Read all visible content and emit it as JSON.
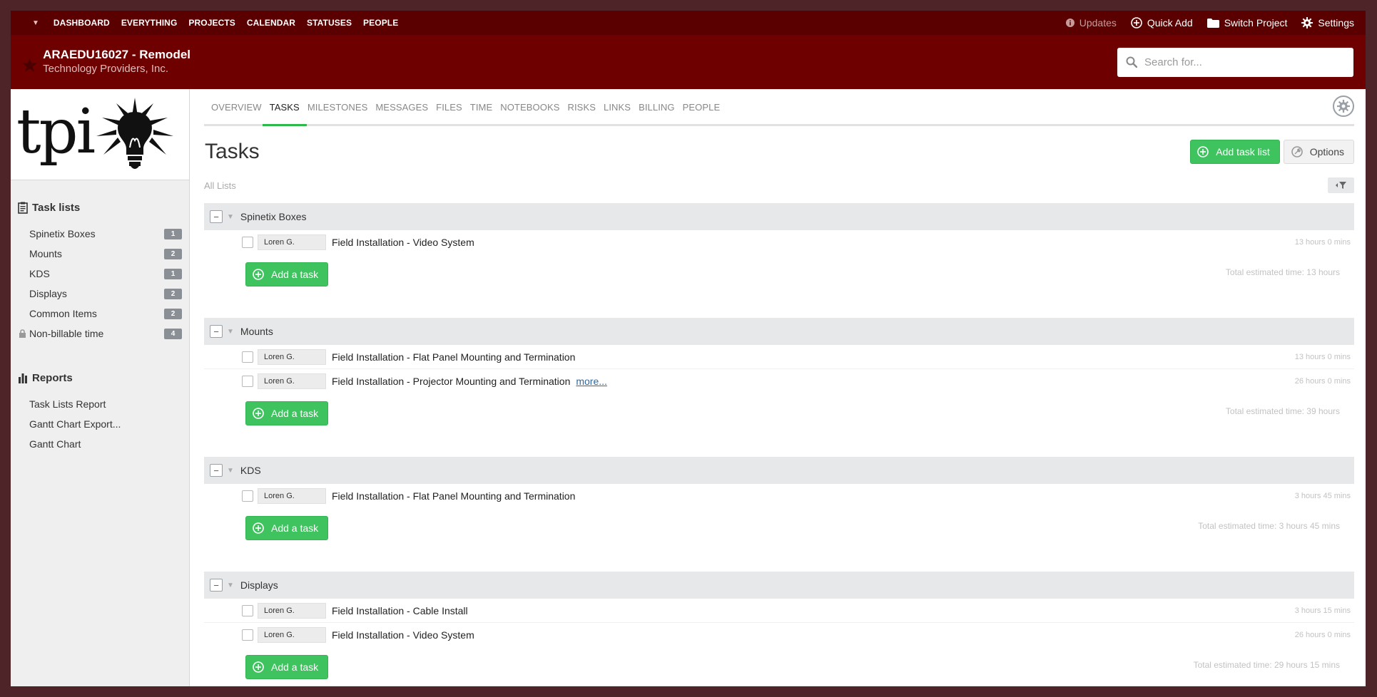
{
  "topnav": {
    "items": [
      "DASHBOARD",
      "EVERYTHING",
      "PROJECTS",
      "CALENDAR",
      "STATUSES",
      "PEOPLE"
    ],
    "updates": "Updates",
    "quick_add": "Quick Add",
    "switch_project": "Switch Project",
    "settings": "Settings"
  },
  "project": {
    "title": "ARAEDU16027 -  Remodel",
    "company": "Technology Providers, Inc."
  },
  "search": {
    "placeholder": "Search for..."
  },
  "logo": {
    "text": "tpi"
  },
  "sidebar": {
    "task_lists_heading": "Task lists",
    "task_lists": [
      {
        "label": "Spinetix Boxes",
        "count": "1"
      },
      {
        "label": "Mounts",
        "count": "2"
      },
      {
        "label": "KDS",
        "count": "1"
      },
      {
        "label": "Displays",
        "count": "2"
      },
      {
        "label": "Common Items",
        "count": "2"
      },
      {
        "label": "Non-billable time",
        "count": "4"
      }
    ],
    "reports_heading": "Reports",
    "reports": [
      "Task Lists Report",
      "Gantt Chart Export...",
      "Gantt Chart"
    ]
  },
  "tabs": [
    "OVERVIEW",
    "TASKS",
    "MILESTONES",
    "MESSAGES",
    "FILES",
    "TIME",
    "NOTEBOOKS",
    "RISKS",
    "LINKS",
    "BILLING",
    "PEOPLE"
  ],
  "page": {
    "title": "Tasks",
    "add_task_list": "Add task list",
    "options": "Options",
    "all_lists": "All Lists"
  },
  "lists": [
    {
      "name": "Spinetix Boxes",
      "tasks": [
        {
          "assignee": "Loren G.",
          "name": "Field Installation - Video System",
          "duration": "13 hours 0 mins"
        }
      ],
      "add_label": "Add a task",
      "total": "Total estimated time: 13 hours"
    },
    {
      "name": "Mounts",
      "tasks": [
        {
          "assignee": "Loren G.",
          "name": "Field Installation - Flat Panel Mounting and Termination",
          "duration": "13 hours 0 mins"
        },
        {
          "assignee": "Loren G.",
          "name": "Field Installation - Projector Mounting and Termination",
          "more": "more...",
          "duration": "26 hours 0 mins"
        }
      ],
      "add_label": "Add a task",
      "total": "Total estimated time: 39 hours"
    },
    {
      "name": "KDS",
      "tasks": [
        {
          "assignee": "Loren G.",
          "name": "Field Installation - Flat Panel Mounting and Termination",
          "duration": "3 hours 45 mins"
        }
      ],
      "add_label": "Add a task",
      "total": "Total estimated time: 3 hours 45 mins"
    },
    {
      "name": "Displays",
      "tasks": [
        {
          "assignee": "Loren G.",
          "name": "Field Installation - Cable Install",
          "duration": "3 hours 15 mins"
        },
        {
          "assignee": "Loren G.",
          "name": "Field Installation - Video System",
          "duration": "26 hours 0 mins"
        }
      ],
      "add_label": "Add a task",
      "total": "Total estimated time: 29 hours 15 mins"
    }
  ],
  "colors": {
    "topbar": "#5a0000",
    "project_header": "#6e0000",
    "accent_green": "#3ec35f",
    "outer_frame": "#4e2429"
  }
}
